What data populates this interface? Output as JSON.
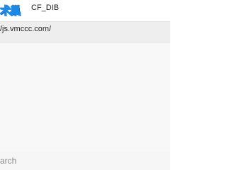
{
  "clipboard_entry": {
    "logo_text": "术巢",
    "format": "CF_DIB"
  },
  "url_row": {
    "text": "/js.vmccc.com/"
  },
  "search": {
    "placeholder": "arch"
  },
  "colors": {
    "logo_accent": "#1e88e5",
    "url_row_bg": "#eeeeee",
    "content_bg": "#f8f8f8",
    "placeholder": "#8a8a8a"
  }
}
